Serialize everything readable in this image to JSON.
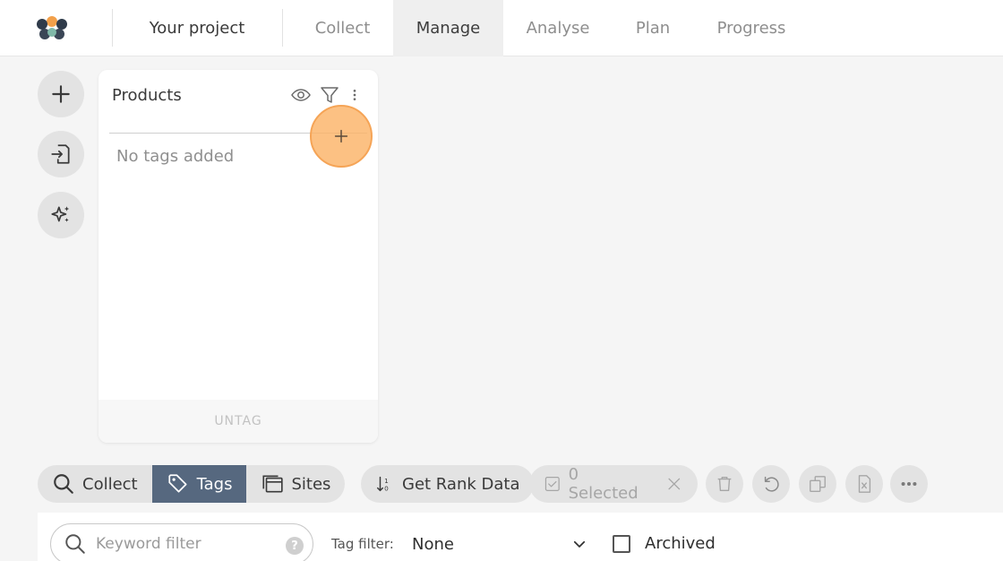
{
  "nav": {
    "project_label": "Your project",
    "tabs": [
      {
        "label": "Collect"
      },
      {
        "label": "Manage"
      },
      {
        "label": "Analyse"
      },
      {
        "label": "Plan"
      },
      {
        "label": "Progress"
      }
    ],
    "active_tab": "Manage"
  },
  "side_actions": [
    {
      "icon": "plus-icon"
    },
    {
      "icon": "import-icon"
    },
    {
      "icon": "sparkle-icon"
    }
  ],
  "card": {
    "title": "Products",
    "empty_text": "No tags added",
    "footer_label": "UNTAG"
  },
  "toolbar": {
    "collect_label": "Collect",
    "tags_label": "Tags",
    "sites_label": "Sites",
    "rank_label": "Get Rank Data",
    "selected_label": "0 Selected"
  },
  "filters": {
    "keyword_placeholder": "Keyword filter",
    "tag_filter_label": "Tag filter:",
    "tag_filter_value": "None",
    "archived_label": "Archived"
  },
  "colors": {
    "active_segment": "#56687f",
    "highlight": "#fbb060"
  }
}
